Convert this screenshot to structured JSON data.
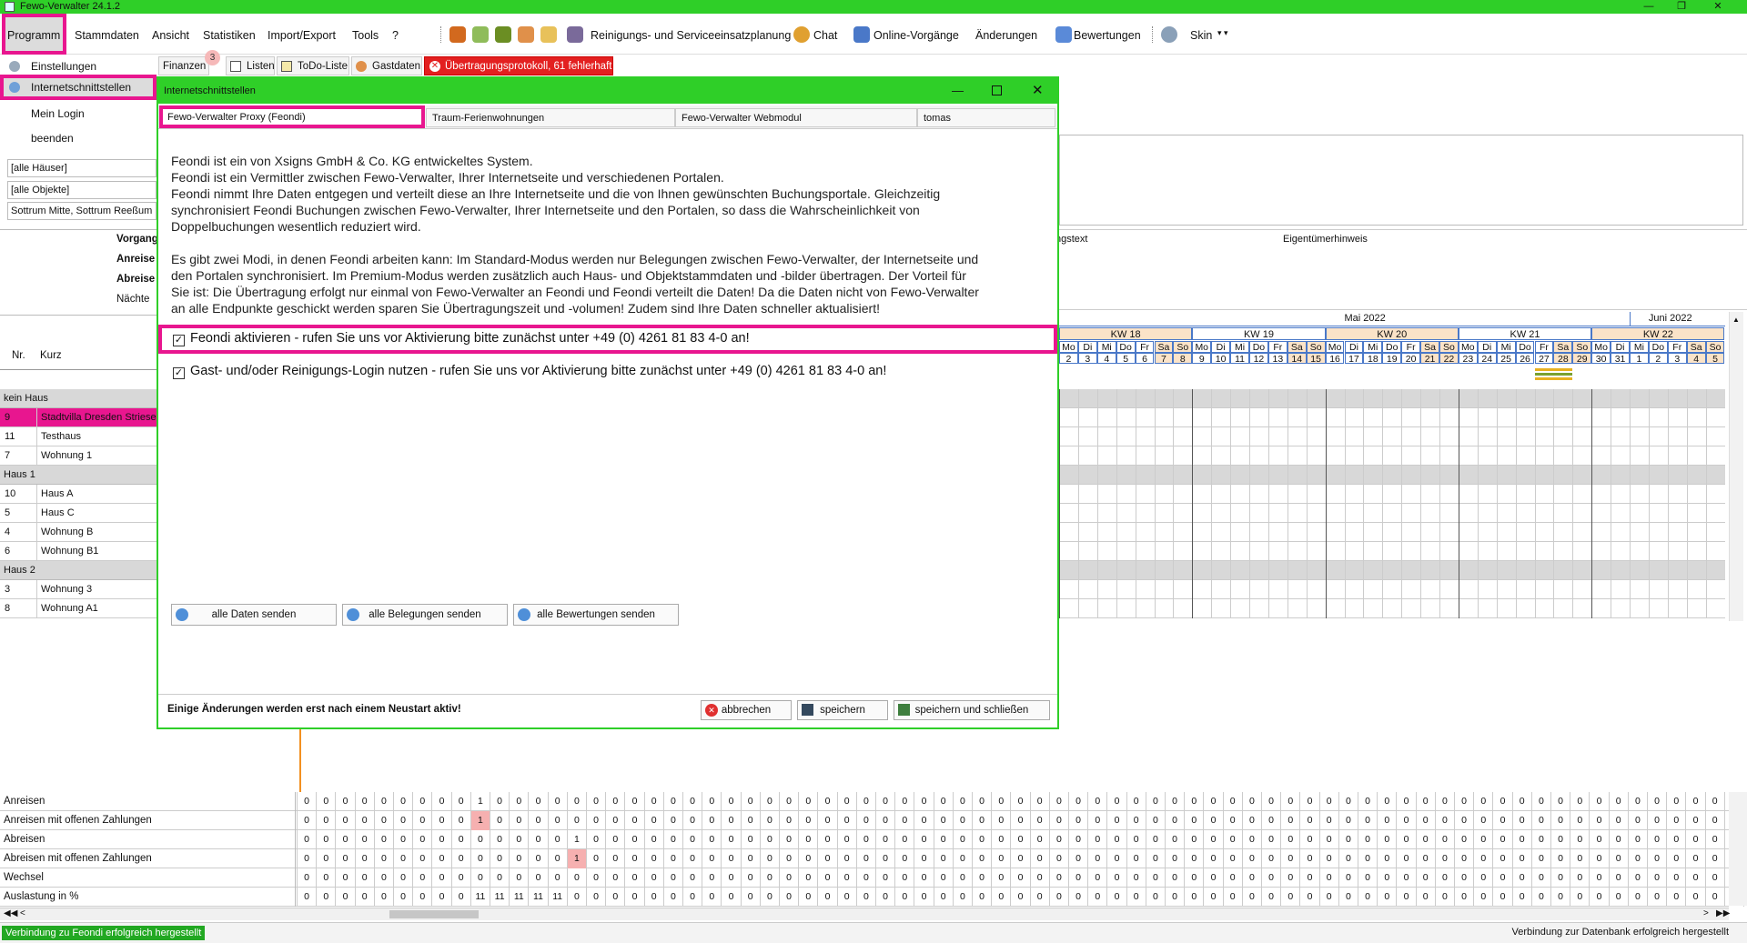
{
  "window": {
    "title": "Fewo-Verwalter 24.1.2",
    "accent": "#2fcf28",
    "highlight": "#e8168f"
  },
  "menu": {
    "items": [
      "Programm",
      "Stammdaten",
      "Ansicht",
      "Statistiken",
      "Import/Export",
      "Tools",
      "?"
    ],
    "right": [
      "Reinigungs- und Serviceeinsatzplanung",
      "Chat",
      "Online-Vorgänge",
      "Änderungen",
      "Bewertungen",
      "Skin"
    ]
  },
  "leftnav": {
    "items": [
      "Einstellungen",
      "Internetschnittstellen",
      "Mein Login",
      "beenden"
    ],
    "fields": [
      "[alle Häuser]",
      "[alle Objekte]",
      "Sottrum Mitte, Sottrum Reeßum"
    ],
    "labels": [
      "Vorgang",
      "Anreise",
      "Abreise",
      "Nächte"
    ],
    "col_nr": "Nr.",
    "col_kurz": "Kurz"
  },
  "tabs": {
    "finanzen": "Finanzen",
    "badge": "3",
    "listen": "Listen",
    "todo": "ToDo-Liste",
    "gastdaten": "Gastdaten",
    "protokoll": "Übertragungsprotokoll, 61 fehlerhaft"
  },
  "right_headers": {
    "h1": "ngstext",
    "h2": "Eigentümerhinweis"
  },
  "calendar": {
    "months": [
      "Mai 2022",
      "Juni 2022"
    ],
    "weeks": [
      "KW 18",
      "KW 19",
      "KW 20",
      "KW 21",
      "KW 22"
    ],
    "days": [
      "Mo",
      "Di",
      "Mi",
      "Do",
      "Fr",
      "Sa",
      "So",
      "Mo",
      "Di",
      "Mi",
      "Do",
      "Fr",
      "Sa",
      "So",
      "Mo",
      "Di",
      "Mi",
      "Do",
      "Fr",
      "Sa",
      "So",
      "Mo",
      "Di",
      "Mi",
      "Do",
      "Fr",
      "Sa",
      "So",
      "Mo",
      "Di",
      "Mi",
      "Do",
      "Fr",
      "Sa",
      "So"
    ],
    "dates": [
      "2",
      "3",
      "4",
      "5",
      "6",
      "7",
      "8",
      "9",
      "10",
      "11",
      "12",
      "13",
      "14",
      "15",
      "16",
      "17",
      "18",
      "19",
      "20",
      "21",
      "22",
      "23",
      "24",
      "25",
      "26",
      "27",
      "28",
      "29",
      "30",
      "31",
      "1",
      "2",
      "3",
      "4",
      "5"
    ]
  },
  "houses": [
    {
      "group": "kein Haus",
      "rows": [
        [
          "9",
          "Stadtvilla Dresden Striesen"
        ],
        [
          "11",
          "Testhaus"
        ],
        [
          "7",
          "Wohnung 1"
        ]
      ]
    },
    {
      "group": "Haus 1",
      "rows": [
        [
          "10",
          "Haus A"
        ],
        [
          "5",
          "Haus C"
        ],
        [
          "4",
          "Wohnung B"
        ],
        [
          "6",
          "Wohnung B1"
        ]
      ]
    },
    {
      "group": "Haus 2",
      "rows": [
        [
          "3",
          "Wohnung 3"
        ],
        [
          "8",
          "Wohnung A1"
        ]
      ]
    }
  ],
  "dialog": {
    "title": "Internetschnittstellen",
    "tabs": [
      "Fewo-Verwalter Proxy (Feondi)",
      "Traum-Ferienwohnungen",
      "Fewo-Verwalter Webmodul",
      "tomas"
    ],
    "para1": [
      "Feondi ist ein von Xsigns GmbH & Co. KG entwickeltes System.",
      "Feondi ist ein Vermittler zwischen Fewo-Verwalter, Ihrer Internetseite und verschiedenen Portalen.",
      "Feondi nimmt Ihre Daten entgegen und verteilt diese an Ihre Internetseite und die von Ihnen gewünschten Buchungsportale. Gleichzeitig",
      "synchronisiert Feondi Buchungen zwischen Fewo-Verwalter, Ihrer Internetseite und den Portalen, so dass die Wahrscheinlichkeit von",
      "Doppelbuchungen wesentlich reduziert wird."
    ],
    "para2": [
      "Es gibt zwei Modi, in denen Feondi arbeiten kann: Im Standard-Modus werden nur Belegungen zwischen Fewo-Verwalter, der Internetseite und",
      "den Portalen synchronisiert. Im Premium-Modus werden zusätzlich auch Haus- und Objektstammdaten und -bilder übertragen. Der Vorteil für",
      "Sie ist: Die Übertragung erfolgt nur einmal von Fewo-Verwalter an Feondi und Feondi verteilt die Daten! Da die Daten nicht von Fewo-Verwalter",
      "an alle Endpunkte geschickt werden sparen Sie Übertragungszeit und -volumen! Zudem sind Ihre Daten schneller aktualisiert!"
    ],
    "check1": "Feondi aktivieren - rufen Sie uns vor Aktivierung bitte zunächst unter +49 (0) 4261 81 83 4-0 an!",
    "check2": "Gast- und/oder Reinigungs-Login nutzen - rufen Sie uns vor Aktivierung bitte zunächst unter +49 (0) 4261 81 83 4-0 an!",
    "btn_all": "alle Daten senden",
    "btn_bel": "alle Belegungen senden",
    "btn_bew": "alle Bewertungen senden",
    "footer_note": "Einige Änderungen werden erst nach einem Neustart aktiv!",
    "btn_cancel": "abbrechen",
    "btn_save": "speichern",
    "btn_saveclose": "speichern und schließen"
  },
  "stats": {
    "rows": [
      {
        "label": "Anreisen",
        "values": [
          "0",
          "0",
          "0",
          "0",
          "0",
          "0",
          "0",
          "0",
          "0",
          "1",
          "0",
          "0",
          "0",
          "0",
          "0",
          "0",
          "0",
          "0",
          "0",
          "0",
          "0",
          "0",
          "0",
          "0",
          "0",
          "0",
          "0",
          "0",
          "0",
          "0",
          "0",
          "0",
          "0",
          "0",
          "0",
          "0",
          "0",
          "0",
          "0",
          "0",
          "0",
          "0",
          "0",
          "0",
          "0",
          "0",
          "0",
          "0",
          "0",
          "0",
          "0",
          "0",
          "0",
          "0",
          "0",
          "0",
          "0",
          "0",
          "0",
          "0",
          "0",
          "0",
          "0",
          "0",
          "0",
          "0",
          "0",
          "0",
          "0",
          "0",
          "0",
          "0",
          "0",
          "0",
          "0",
          "0",
          "0",
          "0",
          "0"
        ]
      },
      {
        "label": "Anreisen mit offenen Zahlungen",
        "values": [
          "0",
          "0",
          "0",
          "0",
          "0",
          "0",
          "0",
          "0",
          "0",
          "1",
          "0",
          "0",
          "0",
          "0",
          "0",
          "0",
          "0",
          "0",
          "0",
          "0",
          "0",
          "0",
          "0",
          "0",
          "0",
          "0",
          "0",
          "0",
          "0",
          "0",
          "0",
          "0",
          "0",
          "0",
          "0",
          "0",
          "0",
          "0",
          "0",
          "0",
          "0",
          "0",
          "0",
          "0",
          "0",
          "0",
          "0",
          "0",
          "0",
          "0",
          "0",
          "0",
          "0",
          "0",
          "0",
          "0",
          "0",
          "0",
          "0",
          "0",
          "0",
          "0",
          "0",
          "0",
          "0",
          "0",
          "0",
          "0",
          "0",
          "0",
          "0",
          "0",
          "0",
          "0",
          "0",
          "0",
          "0",
          "0",
          "0"
        ]
      },
      {
        "label": "Abreisen",
        "values": [
          "0",
          "0",
          "0",
          "0",
          "0",
          "0",
          "0",
          "0",
          "0",
          "0",
          "0",
          "0",
          "0",
          "0",
          "1",
          "0",
          "0",
          "0",
          "0",
          "0",
          "0",
          "0",
          "0",
          "0",
          "0",
          "0",
          "0",
          "0",
          "0",
          "0",
          "0",
          "0",
          "0",
          "0",
          "0",
          "0",
          "0",
          "0",
          "0",
          "0",
          "0",
          "0",
          "0",
          "0",
          "0",
          "0",
          "0",
          "0",
          "0",
          "0",
          "0",
          "0",
          "0",
          "0",
          "0",
          "0",
          "0",
          "0",
          "0",
          "0",
          "0",
          "0",
          "0",
          "0",
          "0",
          "0",
          "0",
          "0",
          "0",
          "0",
          "0",
          "0",
          "0",
          "0",
          "0",
          "0",
          "0",
          "0",
          "0"
        ]
      },
      {
        "label": "Abreisen mit offenen Zahlungen",
        "values": [
          "0",
          "0",
          "0",
          "0",
          "0",
          "0",
          "0",
          "0",
          "0",
          "0",
          "0",
          "0",
          "0",
          "0",
          "1",
          "0",
          "0",
          "0",
          "0",
          "0",
          "0",
          "0",
          "0",
          "0",
          "0",
          "0",
          "0",
          "0",
          "0",
          "0",
          "0",
          "0",
          "0",
          "0",
          "0",
          "0",
          "0",
          "0",
          "0",
          "0",
          "0",
          "0",
          "0",
          "0",
          "0",
          "0",
          "0",
          "0",
          "0",
          "0",
          "0",
          "0",
          "0",
          "0",
          "0",
          "0",
          "0",
          "0",
          "0",
          "0",
          "0",
          "0",
          "0",
          "0",
          "0",
          "0",
          "0",
          "0",
          "0",
          "0",
          "0",
          "0",
          "0",
          "0",
          "0",
          "0",
          "0",
          "0",
          "0"
        ]
      },
      {
        "label": "Wechsel",
        "values": [
          "0",
          "0",
          "0",
          "0",
          "0",
          "0",
          "0",
          "0",
          "0",
          "0",
          "0",
          "0",
          "0",
          "0",
          "0",
          "0",
          "0",
          "0",
          "0",
          "0",
          "0",
          "0",
          "0",
          "0",
          "0",
          "0",
          "0",
          "0",
          "0",
          "0",
          "0",
          "0",
          "0",
          "0",
          "0",
          "0",
          "0",
          "0",
          "0",
          "0",
          "0",
          "0",
          "0",
          "0",
          "0",
          "0",
          "0",
          "0",
          "0",
          "0",
          "0",
          "0",
          "0",
          "0",
          "0",
          "0",
          "0",
          "0",
          "0",
          "0",
          "0",
          "0",
          "0",
          "0",
          "0",
          "0",
          "0",
          "0",
          "0",
          "0",
          "0",
          "0",
          "0",
          "0",
          "0",
          "0",
          "0",
          "0",
          "0"
        ]
      },
      {
        "label": "Auslastung in %",
        "values": [
          "0",
          "0",
          "0",
          "0",
          "0",
          "0",
          "0",
          "0",
          "0",
          "11",
          "11",
          "11",
          "11",
          "11",
          "0",
          "0",
          "0",
          "0",
          "0",
          "0",
          "0",
          "0",
          "0",
          "0",
          "0",
          "0",
          "0",
          "0",
          "0",
          "0",
          "0",
          "0",
          "0",
          "0",
          "0",
          "0",
          "0",
          "0",
          "0",
          "0",
          "0",
          "0",
          "0",
          "0",
          "0",
          "0",
          "0",
          "0",
          "0",
          "0",
          "0",
          "0",
          "0",
          "0",
          "0",
          "0",
          "0",
          "0",
          "0",
          "0",
          "0",
          "0",
          "0",
          "0",
          "0",
          "0",
          "0",
          "0",
          "0",
          "0",
          "0",
          "0",
          "0",
          "0",
          "0",
          "0",
          "0",
          "0",
          "0"
        ]
      }
    ],
    "pink_cells": [
      [
        1,
        9
      ],
      [
        3,
        14
      ]
    ]
  },
  "status": {
    "left": "Verbindung zu Feondi erfolgreich hergestellt",
    "right": "Verbindung zur Datenbank erfolgreich hergestellt"
  }
}
